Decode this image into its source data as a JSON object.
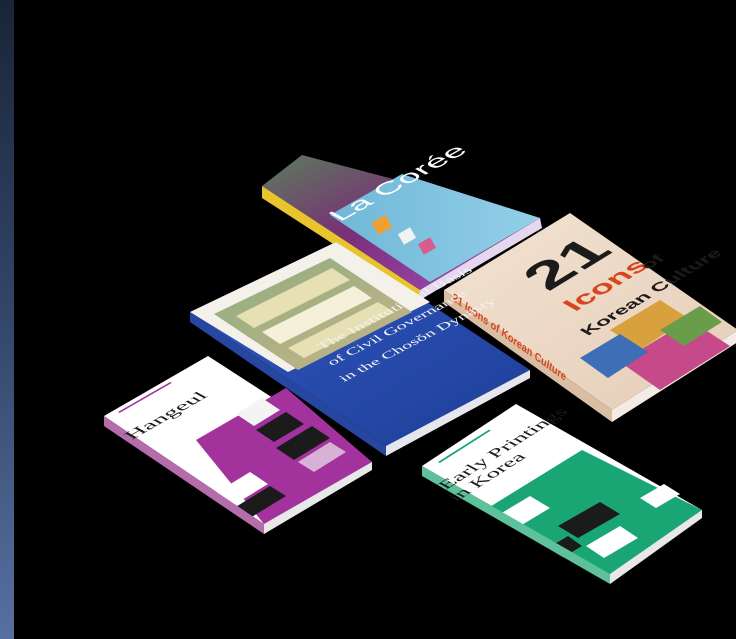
{
  "books": [
    {
      "id": "la-coree",
      "title": "La Corée",
      "spine_text": "La Corée",
      "colors": {
        "cover": "#9b3fb5",
        "bottom": "#6fb7d8",
        "spine": "#e8c52e"
      }
    },
    {
      "id": "21-icons",
      "number": "21",
      "title_line1": "Icons",
      "title_of": "of",
      "title_line2": "Korean Culture",
      "spine_text": "21 Icons of Korean Culture",
      "colors": {
        "cover": "#e9d6c4",
        "accent": "#d9451c",
        "spine": "#e3c9b2"
      }
    },
    {
      "id": "civil-governance",
      "title_line1": "The Institutional Basis",
      "title_line2": "of Civil Governance",
      "title_line3": "in the Chosŏn Dynasty",
      "colors": {
        "cover": "#2b50b4",
        "photo": "#9bb98c",
        "spine": "#2746a0"
      }
    },
    {
      "id": "hangeul",
      "title": "Hangeul",
      "colors": {
        "cover": "#ffffff",
        "band": "#a3329c",
        "spine": "#b46cab"
      }
    },
    {
      "id": "early-printings",
      "title_line1": "Early Printings",
      "title_line2": "in Korea",
      "colors": {
        "cover": "#ffffff",
        "band": "#1aa574",
        "spine": "#5dc19b"
      }
    }
  ]
}
